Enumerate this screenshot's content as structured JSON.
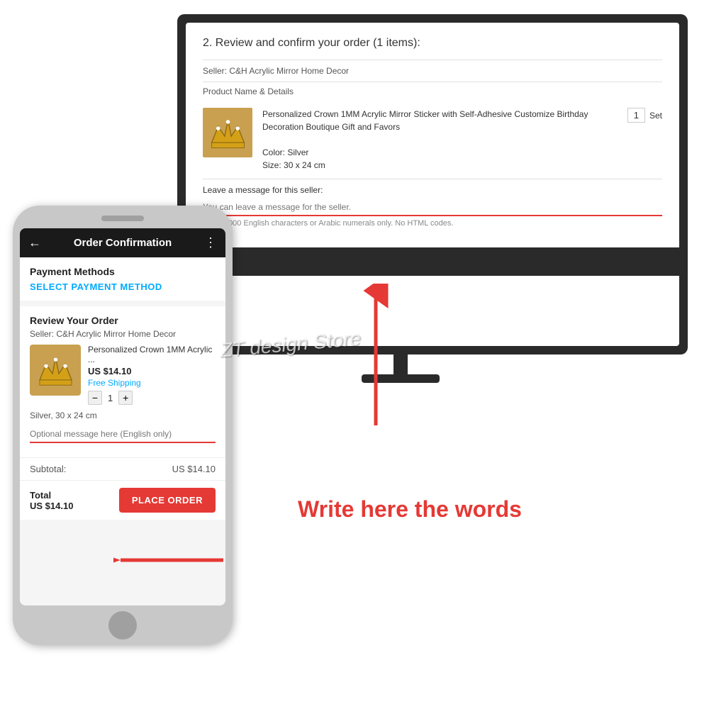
{
  "monitor": {
    "title": "2. Review and confirm your order (1 items):",
    "seller_label": "Seller: C&H Acrylic Mirror Home Decor",
    "product_header": "Product Name & Details",
    "product_name": "Personalized Crown 1MM Acrylic Mirror Sticker with Self-Adhesive Customize Birthday Decoration Boutique Gift and Favors",
    "color_label": "Color:",
    "color_value": "Silver",
    "size_label": "Size:",
    "size_value": "30 x 24 cm",
    "qty": "1",
    "qty_unit": "Set",
    "message_label": "Leave a message for this seller:",
    "message_placeholder": "You can leave a message for the seller.",
    "message_hint": "Max. 1,000 English characters or Arabic numerals only. No HTML codes."
  },
  "phone": {
    "header": {
      "back_icon": "←",
      "title": "Order Confirmation",
      "menu_icon": "⋮"
    },
    "payment_section": {
      "title": "Payment Methods",
      "select_label": "SELECT PAYMENT METHOD"
    },
    "review_section": {
      "title": "Review Your Order",
      "seller": "Seller: C&H Acrylic Mirror Home Decor",
      "product_name": "Personalized Crown 1MM Acrylic ...",
      "price": "US $14.10",
      "shipping": "Free Shipping",
      "qty": "1",
      "variant": "Silver, 30 x 24 cm",
      "message_placeholder": "Optional message here (English only)"
    },
    "subtotal": {
      "label": "Subtotal:",
      "value": "US $14.10"
    },
    "total": {
      "label": "Total",
      "price": "US $14.10",
      "place_order_btn": "PLACE ORDER"
    }
  },
  "annotations": {
    "write_here": "Write here the words",
    "watermark": "ZT design Store"
  }
}
